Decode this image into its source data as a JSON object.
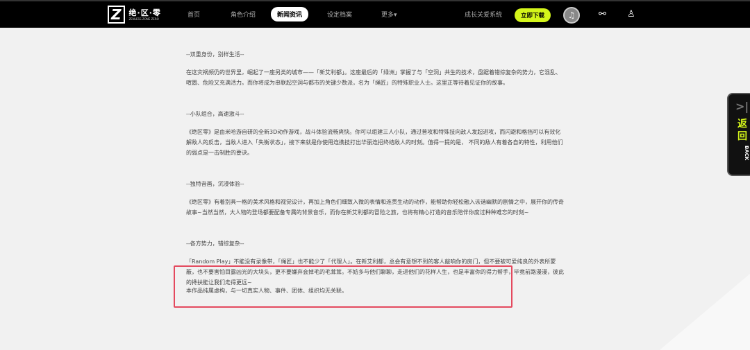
{
  "nav": {
    "logo_title": "绝·区·零",
    "logo_sub": "ZENLESS ZONE ZERO",
    "items": [
      "首页",
      "角色介绍",
      "新闻资讯",
      "设定档案",
      "更多▾"
    ],
    "active": 2,
    "growth": "成长关爱系统",
    "download": "立即下载"
  },
  "article": [
    {
      "heading": "--双重身份，别样生活--",
      "body": "在这灾祸频仍的世界里，崛起了一座另类的城市——「新艾利都」。这座最后的「绿洲」掌握了与「空洞」共生的技术，盘踞着错综复杂的势力，它混乱、喧嚣、危险又充满活力。而你将成为串联起空洞与都市的关键少数派，名为「绳匠」的特殊职业人士。这里正等待着见证你的故事。"
    },
    {
      "heading": "--小队组合，高速激斗--",
      "body": "《绝区零》是由米哈游自研的全新3D动作游戏，战斗体验流畅爽快。你可以组建三人小队，通过普攻和特殊技向敌人发起进攻，而闪避和格挡可以有效化解敌人的反击，当敌人进入「失衡状态」，接下来就是你使用连携技打出华丽连招终结敌人的时刻。值得一提的是， 不同的敌人有着各自的特性，利用他们的弱点是一击制胜的要诀。"
    },
    {
      "heading": "--独特音画，沉浸体验--",
      "body": "《绝区零》有着别具一格的美术风格和视觉设计，再加上角色们细致入微的表情和连贯生动的动作，能帮助你轻松融入诙谐幽默的剧情之中，展开你的传奇故事~当然当然，大人物的登场都要配备专属的背景音乐，而你在新艾利都的冒险之旅，也将有精心打造的音乐陪伴你度过种种难忘的时刻~"
    },
    {
      "heading": "--各方势力，错综复杂--",
      "body": "「Random Play」不能没有录像带，「绳匠」也不能少了「代理人」。在新艾利都，总会有意想不到的客人敲响你的房门，但不要被可爱纯良的外表所蒙蔽，也不要害怕目露凶光的大块头，更不要嫌弃会掉毛的毛茸茸。不妨多与他们聊聊，走进他们的花样人生，也是丰富你的得力帮手，毕竟前路漫漫，彼此的搀扶能让我们走得更远~"
    }
  ],
  "disclaimer": "本作品纯属虚构，与一切真实人物、事件、团体、组织均无关联。",
  "back": {
    "cn": "返回",
    "en": "BACK"
  },
  "colors": {
    "accent": "#d4f51a",
    "highlight_box": "#e4495e"
  }
}
